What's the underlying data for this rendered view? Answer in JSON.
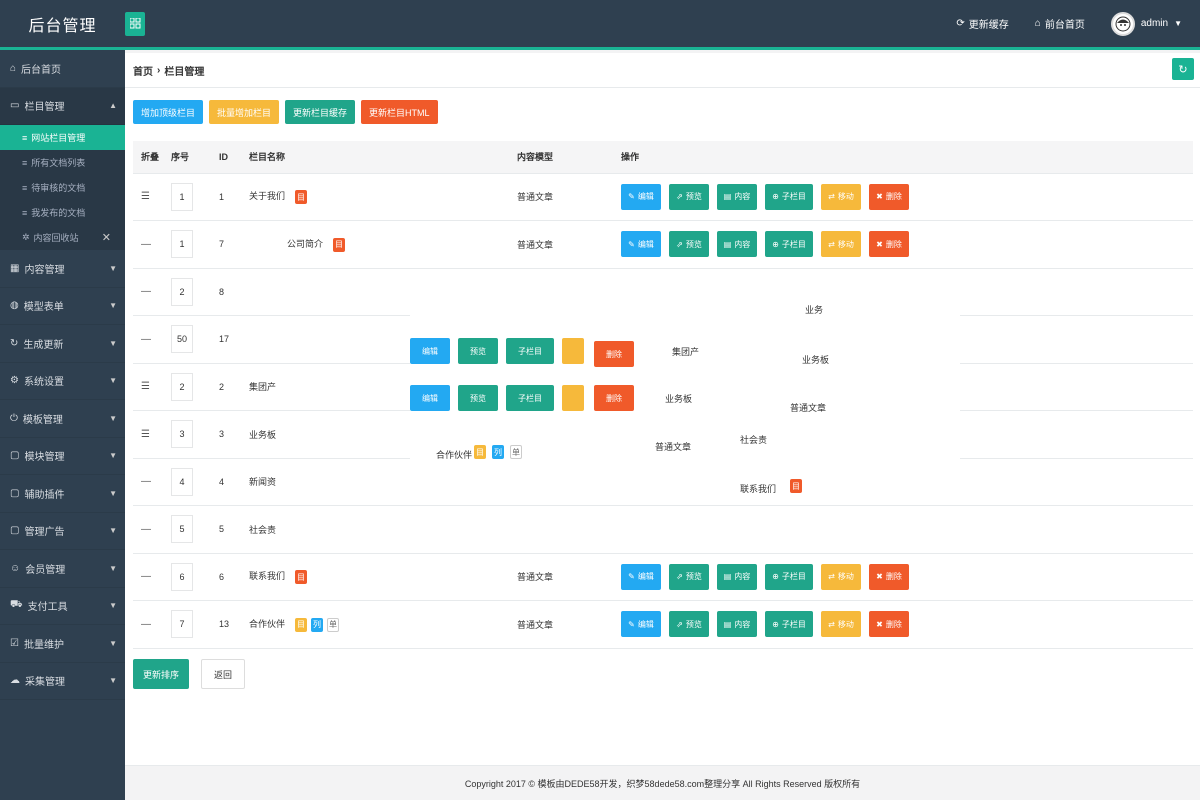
{
  "app": {
    "title": "后台管理"
  },
  "topbar": {
    "clear_cache": "更新缓存",
    "home": "前台首页",
    "user": "admin"
  },
  "sidebar": {
    "items": [
      {
        "label": "后台首页"
      },
      {
        "label": "栏目管理"
      },
      {
        "label": "内容管理"
      },
      {
        "label": "模型表单"
      },
      {
        "label": "生成更新"
      },
      {
        "label": "系统设置"
      },
      {
        "label": "模板管理"
      },
      {
        "label": "模块管理"
      },
      {
        "label": "辅助插件"
      },
      {
        "label": "管理广告"
      },
      {
        "label": "会员管理"
      },
      {
        "label": "支付工具"
      },
      {
        "label": "批量维护"
      },
      {
        "label": "采集管理"
      }
    ],
    "subitems": [
      {
        "label": "网站栏目管理"
      },
      {
        "label": "所有文档列表"
      },
      {
        "label": "待审核的文档"
      },
      {
        "label": "我发布的文档"
      },
      {
        "label": "内容回收站"
      }
    ]
  },
  "breadcrumb": {
    "home": "首页",
    "current": "栏目管理"
  },
  "toolbar": {
    "add_top": "增加顶级栏目",
    "batch_add": "批量增加栏目",
    "update_cache": "更新栏目缓存",
    "update_html": "更新栏目HTML"
  },
  "table": {
    "headers": {
      "fold": "折叠",
      "seq": "序号",
      "id": "ID",
      "name": "栏目名称",
      "model": "内容模型",
      "ops": "操作"
    },
    "ops": {
      "edit": "编辑",
      "view": "预览",
      "content": "内容",
      "sub": "子栏目",
      "move": "移动",
      "del": "删除"
    },
    "rows": [
      {
        "fold": "☰",
        "seq": "1",
        "id": "1",
        "name": "关于我们",
        "tag": "目",
        "model": "普通文章"
      },
      {
        "fold": "—",
        "seq": "1",
        "id": "7",
        "name": "公司简介",
        "tag": "目",
        "model": "普通文章"
      },
      {
        "fold": "—",
        "seq": "2",
        "id": "8",
        "name": "",
        "tag": "",
        "model": ""
      },
      {
        "fold": "—",
        "seq": "50",
        "id": "17",
        "name": "",
        "tag": "",
        "model": ""
      },
      {
        "fold": "☰",
        "seq": "2",
        "id": "2",
        "name": "集团产",
        "tag": "",
        "model": ""
      },
      {
        "fold": "☰",
        "seq": "3",
        "id": "3",
        "name": "业务板",
        "tag": "",
        "model": ""
      },
      {
        "fold": "—",
        "seq": "4",
        "id": "4",
        "name": "新闻资",
        "tag": "",
        "model": ""
      },
      {
        "fold": "—",
        "seq": "5",
        "id": "5",
        "name": "社会责",
        "tag": "",
        "model": ""
      },
      {
        "fold": "—",
        "seq": "6",
        "id": "6",
        "name": "联系我们",
        "tag": "目",
        "model": "普通文章"
      },
      {
        "fold": "—",
        "seq": "7",
        "id": "13",
        "name": "合作伙伴",
        "tag": "",
        "model": "普通文章"
      }
    ]
  },
  "glitch": {
    "t1": "业务",
    "t2": "集团产",
    "t3": "业务板",
    "t4": "业务板",
    "t5": "普通文章",
    "t6": "合作伙伴",
    "t7": "普通文章",
    "t8": "社会责",
    "t9": "联系我们",
    "tag_mu": "目",
    "tag_list": "列",
    "tag_single": "单"
  },
  "bottom": {
    "sort": "更新排序",
    "back": "返回"
  },
  "footer": {
    "text": "Copyright 2017 © 模板由DEDE58开发，织梦58dede58.com整理分享 All Rights Reserved  版权所有"
  }
}
